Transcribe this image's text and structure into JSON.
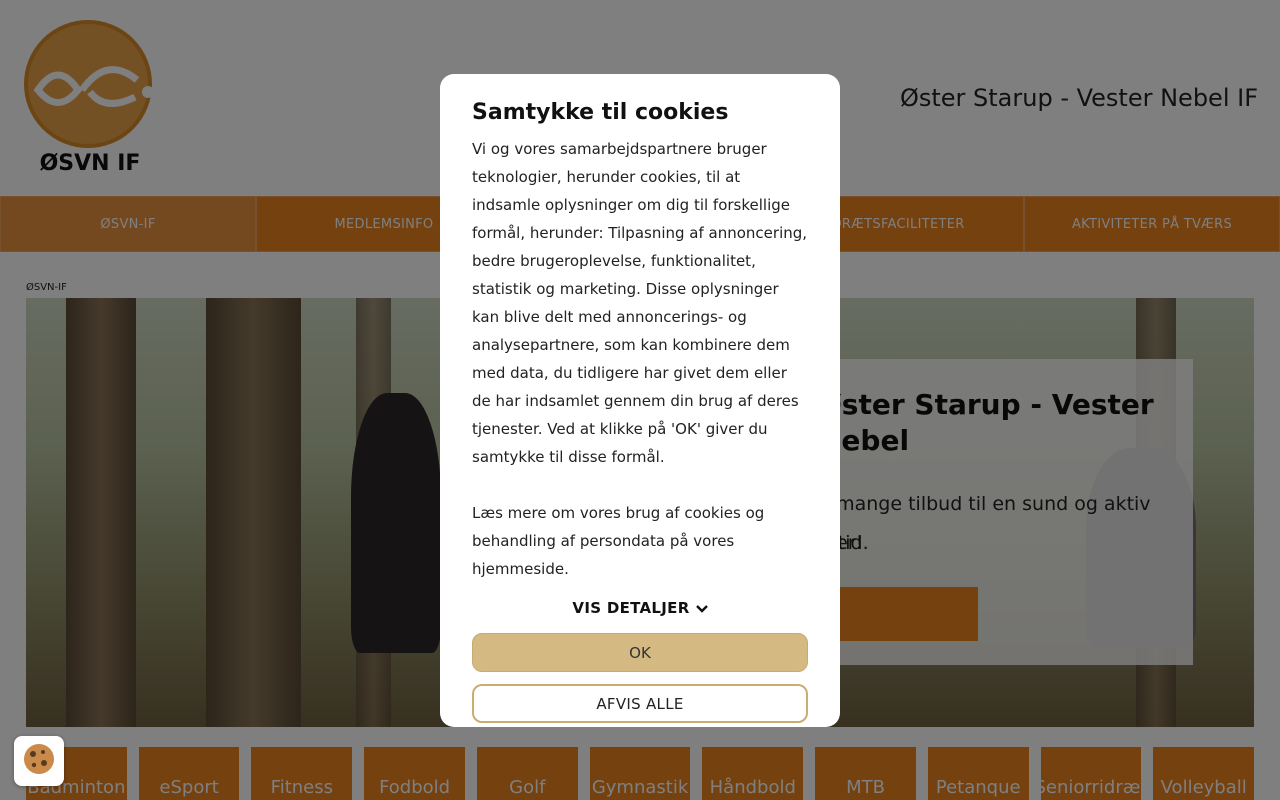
{
  "header": {
    "logo_text": "ØSVN IF",
    "site_title": "Øster Starup - Vester Nebel IF"
  },
  "nav": {
    "items": [
      {
        "label": "ØSVN-IF"
      },
      {
        "label": "MEDLEMSINFO"
      },
      {
        "label": ""
      },
      {
        "label": "IDRÆTSFACILITETER"
      },
      {
        "label": "AKTIVITETER PÅ TVÆRS"
      }
    ]
  },
  "breadcrumb": "ØSVN-IF",
  "hero": {
    "title": "Øster Starup - Vester Nebel",
    "line1": "...mange tilbud til en sund og aktiv fritid.",
    "line2": "...er!"
  },
  "sports": [
    "Badminton",
    "eSport",
    "Fitness",
    "Fodbold",
    "Golf",
    "Gymnastik",
    "Håndbold",
    "MTB",
    "Petanque",
    "Seniorridræt",
    "Volleyball"
  ],
  "cookie": {
    "title": "Samtykke til cookies",
    "body": "Vi og vores samarbejdspartnere bruger teknologier, herunder cookies, til at indsamle oplysninger om dig til forskellige formål, herunder: Tilpasning af annoncering, bedre brugeroplevelse, funktionalitet, statistik og marketing. Disse oplysninger kan blive delt med annoncerings- og analysepartnere, som kan kombinere dem med data, du tidligere har givet dem eller de har indsamlet gennem din brug af deres tjenester. Ved at klikke på 'OK' giver du samtykke til disse formål.",
    "more": "Læs mere om vores brug af cookies og behandling af persondata på vores hjemmeside.",
    "details_label": "VIS DETALJER",
    "ok_label": "OK",
    "reject_label": "AFVIS ALLE"
  },
  "colors": {
    "brand_orange": "#e8821f",
    "ok_button": "#d4b982"
  }
}
